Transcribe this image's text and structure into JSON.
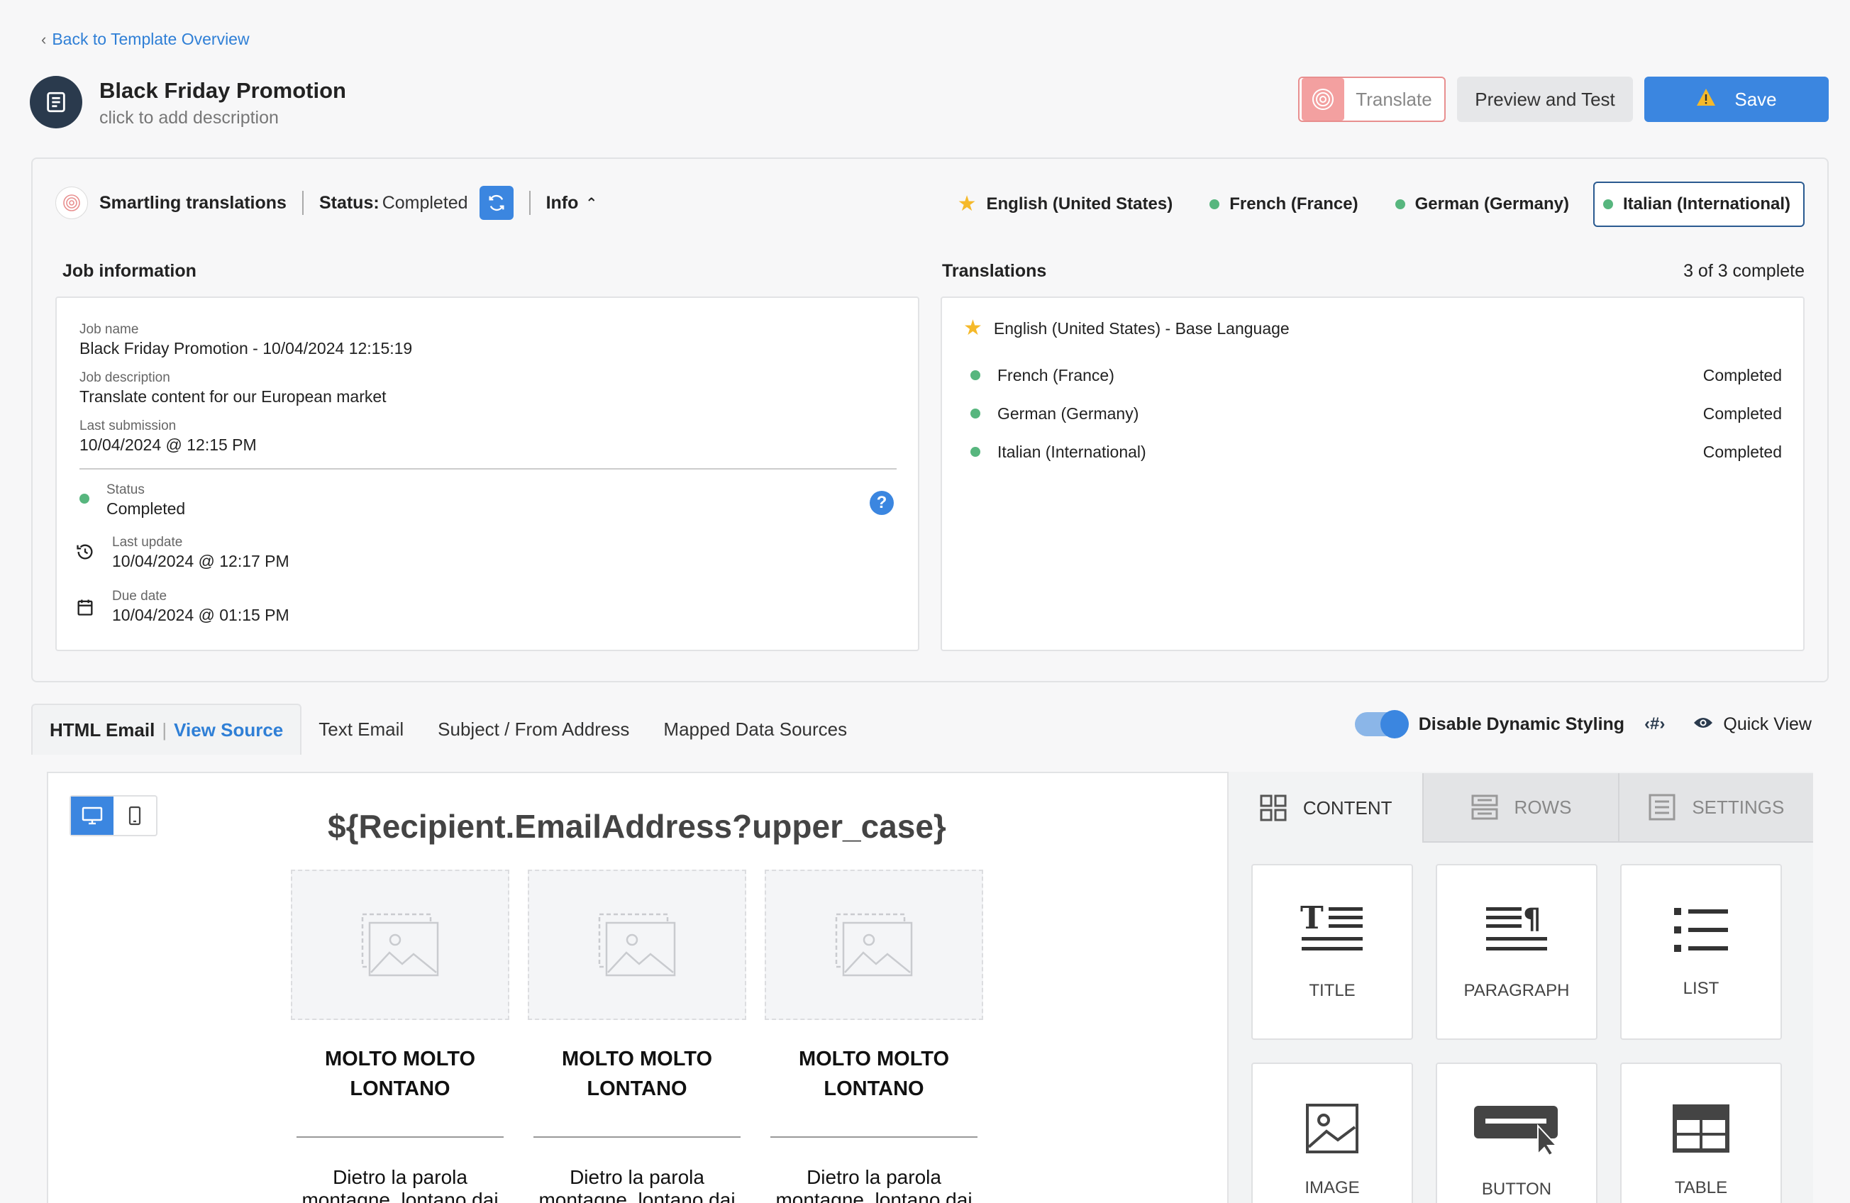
{
  "header": {
    "back_link": "Back to Template Overview",
    "title": "Black Friday Promotion",
    "description_placeholder": "click to add description",
    "translate_label": "Translate",
    "preview_label": "Preview and Test",
    "save_label": "Save"
  },
  "smartling": {
    "name": "Smartling translations",
    "status_label": "Status:",
    "status_value": "Completed",
    "info_label": "Info",
    "languages": [
      {
        "label": "English (United States)",
        "marker": "star-icon"
      },
      {
        "label": "French (France)",
        "marker": "green-dot"
      },
      {
        "label": "German (Germany)",
        "marker": "green-dot"
      },
      {
        "label": "Italian (International)",
        "marker": "green-dot",
        "selected": true
      }
    ]
  },
  "job_info": {
    "heading": "Job information",
    "job_name_label": "Job name",
    "job_name": "Black Friday Promotion - 10/04/2024 12:15:19",
    "job_desc_label": "Job description",
    "job_desc": "Translate content for our European market",
    "last_submission_label": "Last submission",
    "last_submission": "10/04/2024 @ 12:15 PM",
    "status_label": "Status",
    "status": "Completed",
    "last_update_label": "Last update",
    "last_update": "10/04/2024 @ 12:17 PM",
    "due_date_label": "Due date",
    "due_date": "10/04/2024 @ 01:15 PM"
  },
  "translations": {
    "heading": "Translations",
    "summary": "3 of 3 complete",
    "base": "English (United States) - Base Language",
    "rows": [
      {
        "language": "French (France)",
        "status": "Completed"
      },
      {
        "language": "German (Germany)",
        "status": "Completed"
      },
      {
        "language": "Italian (International)",
        "status": "Completed"
      }
    ]
  },
  "editor_tabs": {
    "html_email": "HTML Email",
    "view_source": "View Source",
    "text_email": "Text Email",
    "subject": "Subject / From Address",
    "mapped": "Mapped Data Sources",
    "dynamic_styling": "Disable Dynamic Styling",
    "dynamic_styling_on": true,
    "quick_view": "Quick View"
  },
  "email": {
    "title": "${Recipient.EmailAddress?upper_case}",
    "columns": [
      {
        "heading": "MOLTO MOLTO LONTANO",
        "text": "Dietro la parola montagne, lontano dai"
      },
      {
        "heading": "MOLTO MOLTO LONTANO",
        "text": "Dietro la parola montagne, lontano dai"
      },
      {
        "heading": "MOLTO MOLTO LONTANO",
        "text": "Dietro la parola montagne, lontano dai"
      }
    ]
  },
  "side_panel": {
    "tabs": [
      "CONTENT",
      "ROWS",
      "SETTINGS"
    ],
    "active_tab": "CONTENT",
    "blocks": [
      "TITLE",
      "PARAGRAPH",
      "LIST",
      "IMAGE",
      "BUTTON",
      "TABLE"
    ]
  },
  "colors": {
    "accent": "#3b86e0",
    "status_green": "#57b67e",
    "star": "#f5b92a",
    "translate_border": "#e88f8f"
  }
}
